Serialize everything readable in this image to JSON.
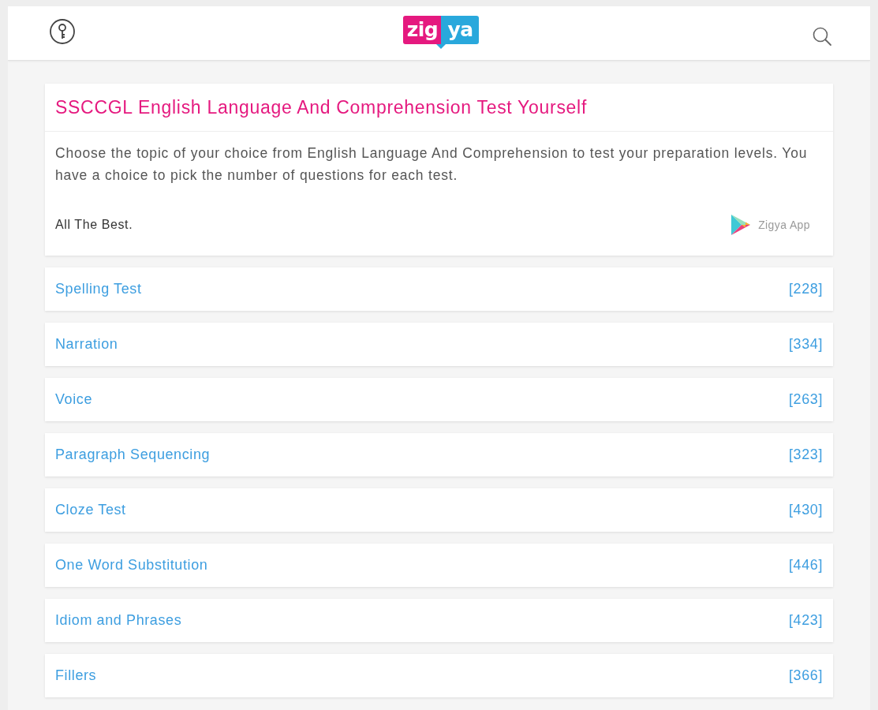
{
  "header": {
    "logo": {
      "left": "zig",
      "right": "ya"
    }
  },
  "intro": {
    "title": "SSCCGL English Language And Comprehension Test Yourself",
    "description": "Choose the topic of your choice from English Language And Comprehension to test your preparation levels. You have a choice to pick the number of questions for each test.",
    "closing": "All The Best.",
    "app_link": "Zigya App"
  },
  "topics": [
    {
      "name": "Spelling Test",
      "count": "[228]"
    },
    {
      "name": "Narration",
      "count": "[334]"
    },
    {
      "name": "Voice",
      "count": "[263]"
    },
    {
      "name": "Paragraph Sequencing",
      "count": "[323]"
    },
    {
      "name": "Cloze Test",
      "count": "[430]"
    },
    {
      "name": "One Word Substitution",
      "count": "[446]"
    },
    {
      "name": "Idiom and Phrases",
      "count": "[423]"
    },
    {
      "name": "Fillers",
      "count": "[366]"
    }
  ]
}
